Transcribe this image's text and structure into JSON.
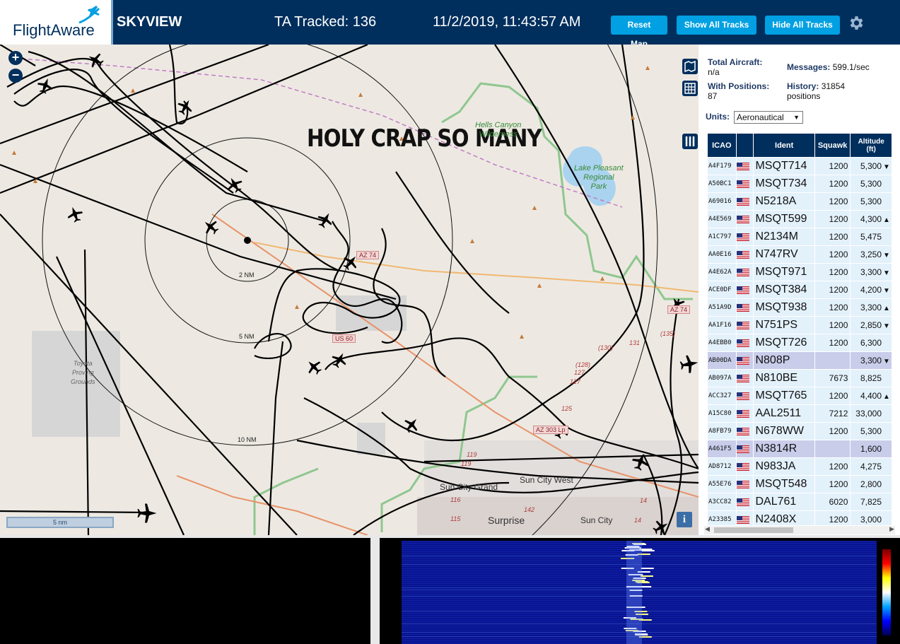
{
  "header": {
    "logo_text": "FlightAware",
    "app_name": "SKYVIEW",
    "tracked_label": "TA Tracked: 136",
    "datetime": "11/2/2019, 11:43:57 AM",
    "buttons": {
      "reset": "Reset Map",
      "show": "Show All Tracks",
      "hide": "Hide All Tracks"
    },
    "colors": {
      "bar": "#002f5d",
      "button": "#00a0e2"
    }
  },
  "map": {
    "annotation": "HOLY CRAP SO MANY",
    "zoom_in": "+",
    "zoom_out": "−",
    "scale": "5 nm",
    "info": "i",
    "ring_labels": {
      "r2": "2 NM",
      "r5": "5 NM",
      "r10": "10 NM"
    },
    "places": {
      "hells_canyon": "Hells Canyon",
      "hells_canyon2": "Wilderness",
      "lake_pleasant": "Lake Pleasant",
      "regional": "Regional",
      "park": "Park",
      "toyota": "Toyota",
      "proving": "Proving",
      "grounds": "Grounds",
      "sun_city_grand": "Sun City Grand",
      "sun_city_west": "Sun City West",
      "surprise": "Surprise",
      "sun_city": "Sun City"
    },
    "road_shields": {
      "az74": "AZ 74",
      "us60": "US 60",
      "az303": "AZ 303 Lp",
      "az74b": "AZ 74"
    },
    "road_numbers": {
      "n130": "(130)",
      "n131": "131",
      "n135": "(135)",
      "n128": "(128)",
      "n127": "127",
      "n127b": "127",
      "n125": "125",
      "n119": "119",
      "n119b": "119",
      "n116": "116",
      "n142": "142",
      "n115": "115",
      "n14": "14",
      "n14b": "14",
      "n4": "14"
    }
  },
  "sidebar": {
    "total_label": "Total Aircraft:",
    "total_value": "n/a",
    "messages_label": "Messages:",
    "messages_value": "599.1/sec",
    "positions_label": "With Positions:",
    "positions_value": "87",
    "history_label": "History:",
    "history_value": "31854",
    "history_unit": "positions",
    "units_label": "Units:",
    "units_value": "Aeronautical",
    "columns": {
      "icao": "ICAO",
      "ident": "Ident",
      "squawk": "Squawk",
      "alt1": "Altitude",
      "alt2": "(ft)"
    },
    "rows": [
      {
        "icao": "A4F179",
        "ident": "MSQT714",
        "squawk": "1200",
        "alt": "5,300",
        "trend": "▼",
        "sel": false
      },
      {
        "icao": "A50BC1",
        "ident": "MSQT734",
        "squawk": "1200",
        "alt": "5,300",
        "trend": "",
        "sel": false
      },
      {
        "icao": "A69016",
        "ident": "N5218A",
        "squawk": "1200",
        "alt": "5,300",
        "trend": "",
        "sel": false
      },
      {
        "icao": "A4E569",
        "ident": "MSQT599",
        "squawk": "1200",
        "alt": "4,300",
        "trend": "▲",
        "sel": false
      },
      {
        "icao": "A1C797",
        "ident": "N2134M",
        "squawk": "1200",
        "alt": "5,475",
        "trend": "",
        "sel": false
      },
      {
        "icao": "AA0E16",
        "ident": "N747RV",
        "squawk": "1200",
        "alt": "3,250",
        "trend": "▼",
        "sel": false
      },
      {
        "icao": "A4E62A",
        "ident": "MSQT971",
        "squawk": "1200",
        "alt": "3,300",
        "trend": "▼",
        "sel": false
      },
      {
        "icao": "ACE0DF",
        "ident": "MSQT384",
        "squawk": "1200",
        "alt": "4,200",
        "trend": "▼",
        "sel": false
      },
      {
        "icao": "A51A9D",
        "ident": "MSQT938",
        "squawk": "1200",
        "alt": "3,300",
        "trend": "▲",
        "sel": false
      },
      {
        "icao": "AA1F16",
        "ident": "N751PS",
        "squawk": "1200",
        "alt": "2,850",
        "trend": "▼",
        "sel": false
      },
      {
        "icao": "A4EBB0",
        "ident": "MSQT726",
        "squawk": "1200",
        "alt": "6,300",
        "trend": "",
        "sel": false
      },
      {
        "icao": "AB00DA",
        "ident": "N808P",
        "squawk": "",
        "alt": "3,300",
        "trend": "▼",
        "sel": true
      },
      {
        "icao": "AB097A",
        "ident": "N810BE",
        "squawk": "7673",
        "alt": "8,825",
        "trend": "",
        "sel": false
      },
      {
        "icao": "ACC327",
        "ident": "MSQT765",
        "squawk": "1200",
        "alt": "4,400",
        "trend": "▲",
        "sel": false
      },
      {
        "icao": "A15C80",
        "ident": "AAL2511",
        "squawk": "7212",
        "alt": "33,000",
        "trend": "",
        "sel": false
      },
      {
        "icao": "A8FB79",
        "ident": "N678WW",
        "squawk": "1200",
        "alt": "5,300",
        "trend": "",
        "sel": false
      },
      {
        "icao": "A461F5",
        "ident": "N3814R",
        "squawk": "",
        "alt": "1,600",
        "trend": "",
        "sel": true
      },
      {
        "icao": "AD8712",
        "ident": "N983JA",
        "squawk": "1200",
        "alt": "4,275",
        "trend": "",
        "sel": false
      },
      {
        "icao": "A55E76",
        "ident": "MSQT548",
        "squawk": "1200",
        "alt": "2,800",
        "trend": "",
        "sel": false
      },
      {
        "icao": "A3CC82",
        "ident": "DAL761",
        "squawk": "6020",
        "alt": "7,825",
        "trend": "",
        "sel": false
      },
      {
        "icao": "A23385",
        "ident": "N2408X",
        "squawk": "1200",
        "alt": "3,000",
        "trend": "",
        "sel": false
      }
    ]
  }
}
